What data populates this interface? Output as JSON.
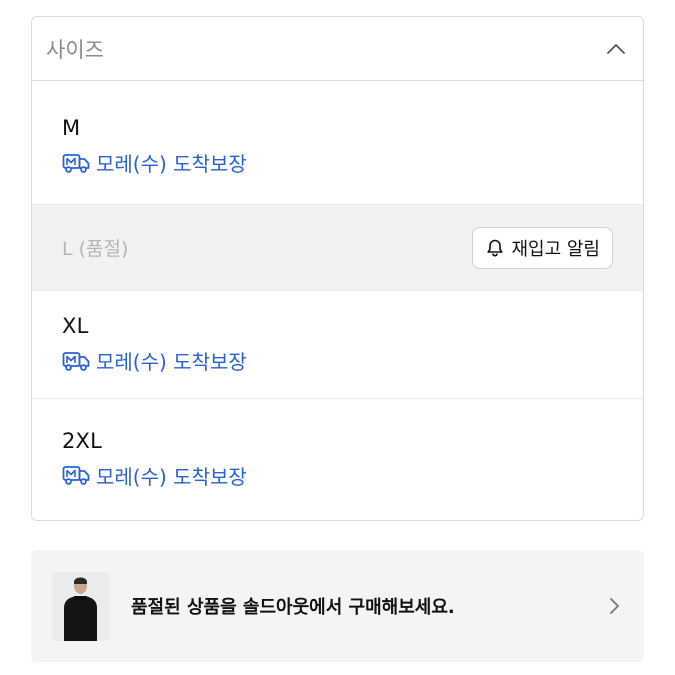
{
  "dropdown": {
    "title": "사이즈",
    "icon": "chevron-up-icon"
  },
  "options": [
    {
      "size": "M",
      "shipping": "모레(수) 도착보장",
      "soldout": false
    },
    {
      "size": "L (품절)",
      "soldout": true,
      "button_label": "재입고 알림"
    },
    {
      "size": "XL",
      "shipping": "모레(수) 도착보장",
      "soldout": false
    },
    {
      "size": "2XL",
      "shipping": "모레(수) 도착보장",
      "soldout": false
    }
  ],
  "banner": {
    "text": "품절된 상품을 솔드아웃에서 구매해보세요.",
    "icon": "chevron-right-icon"
  },
  "colors": {
    "accent_blue": "#2a62d1",
    "muted_text": "#8a8a8a",
    "soldout_bg": "#f2f2f2"
  }
}
